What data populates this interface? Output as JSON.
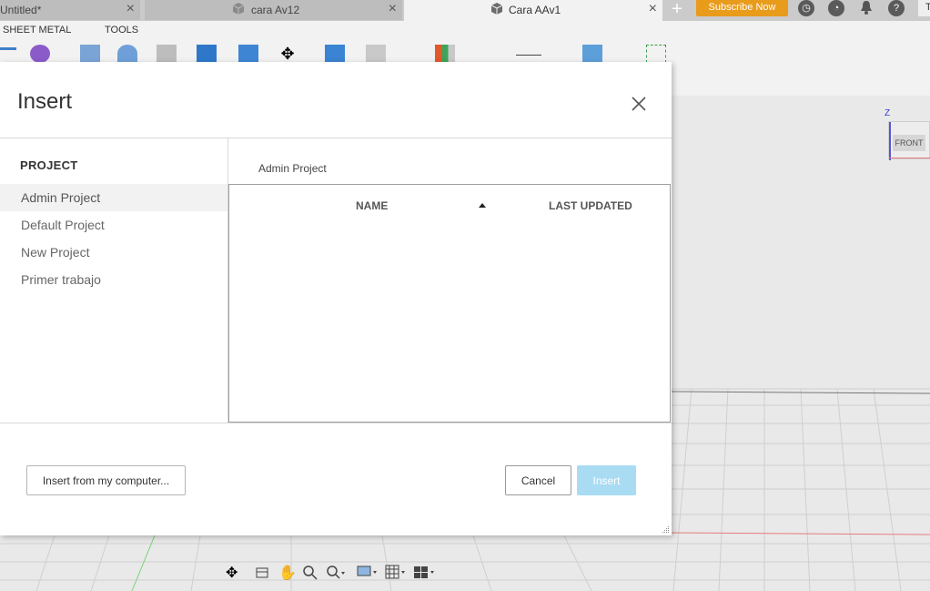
{
  "tabs": [
    {
      "label": "Untitled*"
    },
    {
      "label": "cara Av12"
    },
    {
      "label": "Cara AAv1"
    }
  ],
  "header": {
    "subscribe_label": "Subscribe Now",
    "help_glyph": "?",
    "user_initial": "T"
  },
  "toolbar": {
    "sections": [
      "SHEET METAL",
      "TOOLS"
    ]
  },
  "viewcube": {
    "face": "FRONT",
    "axis": "Z"
  },
  "dialog": {
    "title": "Insert",
    "sidebar_title": "PROJECT",
    "projects": [
      {
        "label": "Admin Project",
        "selected": true
      },
      {
        "label": "Default Project",
        "selected": false
      },
      {
        "label": "New Project",
        "selected": false
      },
      {
        "label": "Primer trabajo",
        "selected": false
      }
    ],
    "breadcrumb": "Admin Project",
    "columns": {
      "name": "NAME",
      "updated": "LAST UPDATED"
    },
    "buttons": {
      "from_computer": "Insert from my computer...",
      "cancel": "Cancel",
      "insert": "Insert"
    }
  },
  "colors": {
    "accent_subscribe": "#e99b1b",
    "insert_disabled": "#a9dcf3"
  },
  "icons": [
    "close-icon",
    "cube-icon",
    "plus-icon",
    "help-icon",
    "notification-icon",
    "history-icon",
    "sort-ascending-icon",
    "orbit-icon",
    "pan-icon",
    "zoom-icon",
    "display-icon",
    "grid-icon",
    "viewports-icon"
  ]
}
